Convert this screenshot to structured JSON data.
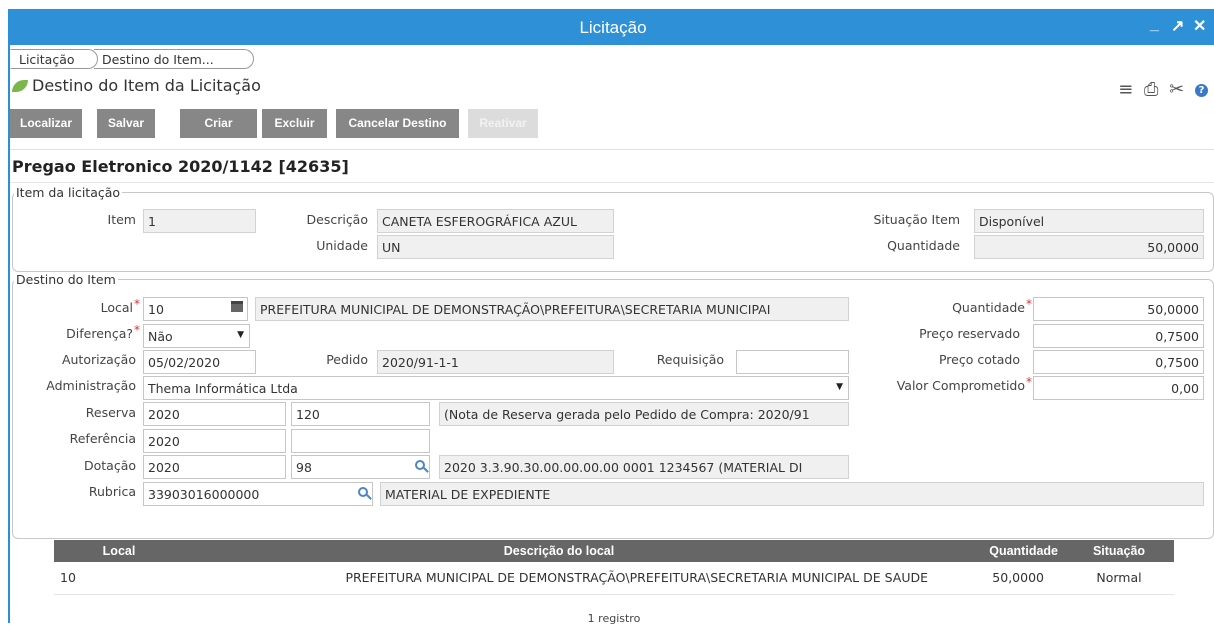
{
  "window": {
    "title": "Licitação",
    "minimize": "_",
    "maximize": "↗",
    "close": "✕"
  },
  "breadcrumbs": [
    "Licitação",
    "Destino do Item..."
  ],
  "screen_title": "Destino do Item da Licitação",
  "toolbar": [
    "Localizar",
    "Salvar",
    "Criar",
    "Excluir",
    "Cancelar Destino",
    "Reativar"
  ],
  "icons": [
    "menu-icon",
    "print-icon",
    "tools-icon",
    "help-icon"
  ],
  "heading": "Pregao Eletronico 2020/1142 [42635]",
  "item_section": {
    "legend": "Item da licitação",
    "item_label": "Item",
    "item_value": "1",
    "descricao_label": "Descrição",
    "descricao_value": "CANETA ESFEROGRÁFICA AZUL",
    "situacao_label": "Situação Item",
    "situacao_value": "Disponível",
    "unidade_label": "Unidade",
    "unidade_value": "UN",
    "quantidade_label": "Quantidade",
    "quantidade_value": "50,0000"
  },
  "destino_section": {
    "legend": "Destino do Item",
    "local_label": "Local",
    "local_code": "10",
    "local_desc": "PREFEITURA MUNICIPAL DE DEMONSTRAÇÃO\\PREFEITURA\\SECRETARIA MUNICIPAI",
    "diferenca_label": "Diferença?",
    "diferenca_value": "Não",
    "autorizacao_label": "Autorização",
    "autorizacao_value": "05/02/2020",
    "pedido_label": "Pedido",
    "pedido_value": "2020/91-1-1",
    "requisicao_label": "Requisição",
    "requisicao_value": "",
    "administracao_label": "Administração",
    "administracao_value": "Thema Informática Ltda",
    "reserva_label": "Reserva",
    "reserva_ano": "2020",
    "reserva_num": "120",
    "reserva_desc": "(Nota de Reserva gerada pelo Pedido de Compra: 2020/91",
    "referencia_label": "Referência",
    "referencia_ano": "2020",
    "referencia_num": "",
    "dotacao_label": "Dotação",
    "dotacao_ano": "2020",
    "dotacao_num": "98",
    "dotacao_desc": "2020 3.3.90.30.00.00.00.00 0001 1234567 (MATERIAL DI",
    "rubrica_label": "Rubrica",
    "rubrica_value": "33903016000000",
    "rubrica_desc": "MATERIAL DE EXPEDIENTE",
    "quantidade_label": "Quantidade",
    "quantidade_value": "50,0000",
    "preco_reservado_label": "Preço reservado",
    "preco_reservado_value": "0,7500",
    "preco_cotado_label": "Preço cotado",
    "preco_cotado_value": "0,7500",
    "valor_comprometido_label": "Valor Comprometido",
    "valor_comprometido_value": "0,00"
  },
  "grid": {
    "headers": [
      "Local",
      "Descrição do local",
      "Quantidade",
      "Situação"
    ],
    "rows": [
      [
        "10",
        "PREFEITURA MUNICIPAL DE DEMONSTRAÇÃO\\PREFEITURA\\SECRETARIA MUNICIPAL DE SAUDE",
        "50,0000",
        "Normal"
      ]
    ],
    "count": "1 registro"
  },
  "colors": {
    "titlebar": "#2e91d8",
    "button": "#878787",
    "grid_header": "#666666",
    "required": "#e03030"
  }
}
